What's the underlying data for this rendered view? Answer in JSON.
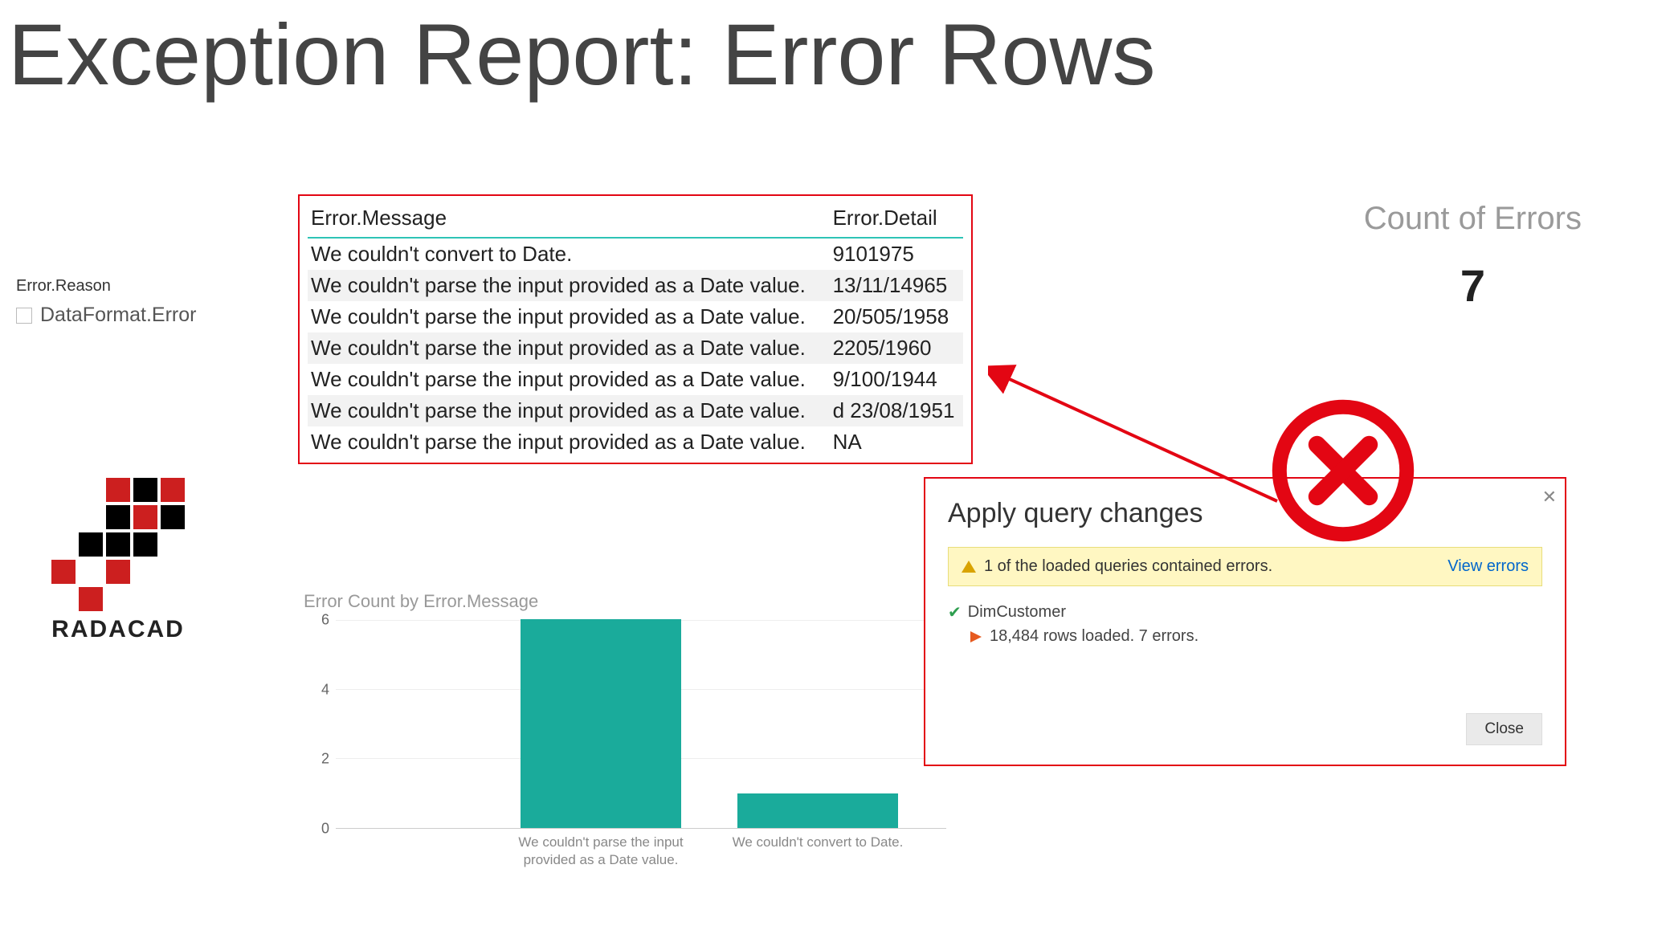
{
  "page": {
    "title": "Exception Report: Error Rows"
  },
  "slicer": {
    "header": "Error.Reason",
    "items": [
      {
        "label": "DataFormat.Error",
        "checked": false
      }
    ]
  },
  "logo": {
    "text": "RADACAD"
  },
  "error_table": {
    "headers": {
      "message": "Error.Message",
      "detail": "Error.Detail"
    },
    "rows": [
      {
        "message": "We couldn't convert to Date.",
        "detail": "9101975"
      },
      {
        "message": "We couldn't parse the input provided as a Date value.",
        "detail": "13/11/14965"
      },
      {
        "message": "We couldn't parse the input provided as a Date value.",
        "detail": "20/505/1958"
      },
      {
        "message": "We couldn't parse the input provided as a Date value.",
        "detail": "2205/1960"
      },
      {
        "message": "We couldn't parse the input provided as a Date value.",
        "detail": "9/100/1944"
      },
      {
        "message": "We couldn't parse the input provided as a Date value.",
        "detail": "d 23/08/1951"
      },
      {
        "message": "We couldn't parse the input provided as a Date value.",
        "detail": "NA"
      }
    ]
  },
  "count_card": {
    "title": "Count of Errors",
    "value": "7"
  },
  "chart_data": {
    "type": "bar",
    "title": "Error Count by Error.Message",
    "categories": [
      "We couldn't parse the input provided as a Date value.",
      "We couldn't convert to Date."
    ],
    "values": [
      6,
      1
    ],
    "ylim": [
      0,
      6
    ],
    "yticks": [
      0,
      2,
      4,
      6
    ],
    "xlabel": "",
    "ylabel": ""
  },
  "dialog": {
    "title": "Apply query changes",
    "warning_text": "1 of the loaded queries contained errors.",
    "link_text": "View errors",
    "query_name": "DimCustomer",
    "query_detail": "18,484 rows loaded. 7 errors.",
    "close_label": "Close"
  }
}
